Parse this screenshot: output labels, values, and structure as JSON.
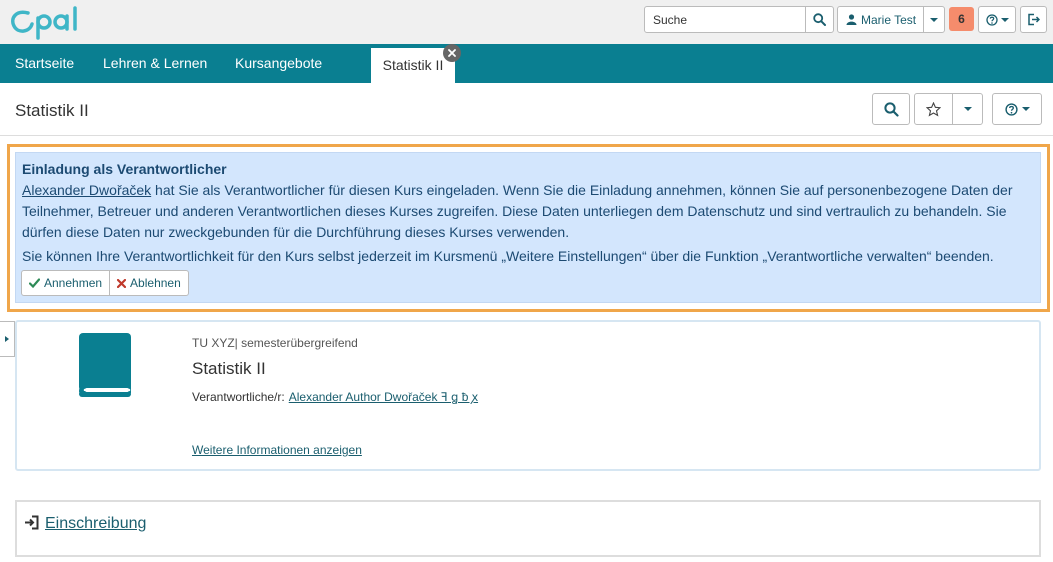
{
  "topbar": {
    "logo_text": "Opal",
    "search": {
      "placeholder": "Suche"
    },
    "user_name": "Marie Test",
    "notification_count": "6",
    "brand_color": "#0a7f91"
  },
  "nav": {
    "items": [
      "Startseite",
      "Lehren & Lernen",
      "Kursangebote"
    ],
    "active_tab": "Statistik II"
  },
  "page": {
    "title": "Statistik II"
  },
  "invitation": {
    "title": "Einladung als Verantwortlicher",
    "inviter": "Alexander Dwořaček",
    "text": " hat Sie als Verantwortlicher für diesen Kurs eingeladen. Wenn Sie die Einladung annehmen, können Sie auf personenbezogene Daten der Teilnehmer, Betreuer und anderen Verantwortlichen dieses Kurses zugreifen. Diese Daten unterliegen dem Datenschutz und sind vertraulich zu behandeln. Sie dürfen diese Daten nur zweckgebunden für die Durchführung dieses Kurses verwenden.",
    "text2": "Sie können Ihre Verantwortlichkeit für den Kurs selbst jederzeit im Kursmenü „Weitere Einstellungen“ über die Funktion „Verantwortliche verwalten“ beenden.",
    "accept_label": "Annehmen",
    "decline_label": "Ablehnen"
  },
  "course": {
    "semester": "TU XYZ| semesterübergreifend",
    "title": "Statistik II",
    "responsible_label": "Verantwortliche/r:",
    "responsible_name": "Alexander Author Dwořaček ꟻ ꬶ ƀ ꭗ",
    "more_info_label": "Weitere Informationen anzeigen"
  },
  "enrolment": {
    "label": "Einschreibung"
  }
}
